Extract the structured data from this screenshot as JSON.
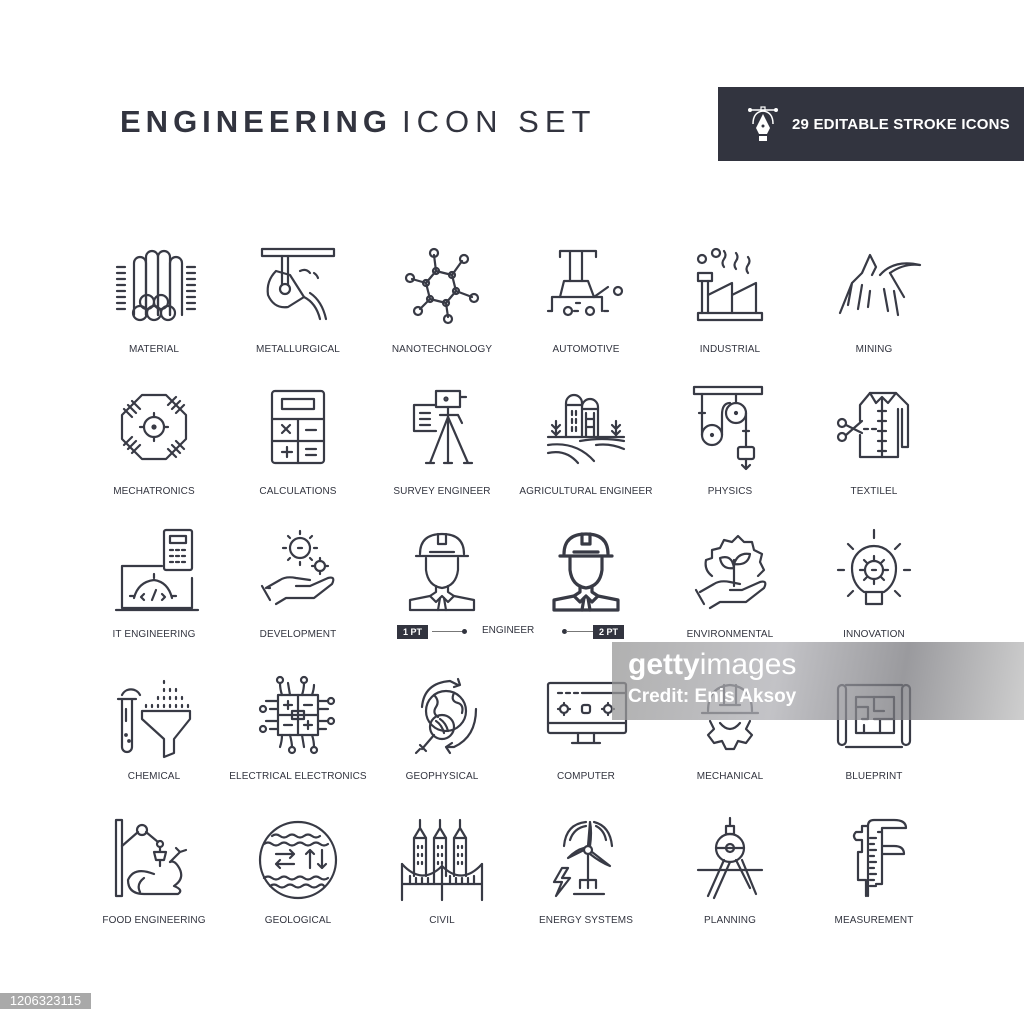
{
  "header": {
    "title_bold": "ENGINEERING",
    "title_light": "ICON SET",
    "badge_icon": "pen-tool-icon",
    "badge_text": "29 EDITABLE STROKE ICONS"
  },
  "icons": [
    {
      "label": "MATERIAL",
      "icon": "pipes-icon"
    },
    {
      "label": "METALLURGICAL",
      "icon": "ladle-icon"
    },
    {
      "label": "NANOTECHNOLOGY",
      "icon": "molecule-icon"
    },
    {
      "label": "AUTOMOTIVE",
      "icon": "car-lift-icon"
    },
    {
      "label": "INDUSTRIAL",
      "icon": "factory-icon"
    },
    {
      "label": "MINING",
      "icon": "pickaxe-mountain-icon"
    },
    {
      "label": "MECHATRONICS",
      "icon": "circuit-octagon-icon"
    },
    {
      "label": "CALCULATIONS",
      "icon": "calculator-icon"
    },
    {
      "label": "SURVEY ENGINEER",
      "icon": "survey-tripod-icon"
    },
    {
      "label": "AGRICULTURAL ENGINEER",
      "icon": "farm-silo-icon"
    },
    {
      "label": "PHYSICS",
      "icon": "pulley-icon"
    },
    {
      "label": "TEXTILEL",
      "icon": "shirt-scissors-icon"
    },
    {
      "label": "IT ENGINEERING",
      "icon": "laptop-code-icon"
    },
    {
      "label": "DEVELOPMENT",
      "icon": "hand-gears-icon"
    },
    {
      "label": "",
      "icon": "engineer-thin-icon"
    },
    {
      "label": "",
      "icon": "engineer-bold-icon"
    },
    {
      "label": "ENVIRONMENTAL",
      "icon": "hand-plant-gear-icon"
    },
    {
      "label": "INNOVATION",
      "icon": "lightbulb-gear-icon"
    },
    {
      "label": "CHEMICAL",
      "icon": "test-tube-funnel-icon"
    },
    {
      "label": "ELECTRICAL ELECTRONICS",
      "icon": "chip-icon"
    },
    {
      "label": "GEOPHYSICAL",
      "icon": "globe-magnifier-icon"
    },
    {
      "label": "COMPUTER",
      "icon": "monitor-gears-icon"
    },
    {
      "label": "MECHANICAL",
      "icon": "helmet-gear-icon"
    },
    {
      "label": "BLUEPRINT",
      "icon": "blueprint-icon"
    },
    {
      "label": "FOOD ENGINEERING",
      "icon": "robot-arm-chicken-icon"
    },
    {
      "label": "GEOLOGICAL",
      "icon": "earth-layers-icon"
    },
    {
      "label": "CIVIL",
      "icon": "towers-bridge-icon"
    },
    {
      "label": "ENERGY SYSTEMS",
      "icon": "wind-turbine-icon"
    },
    {
      "label": "PLANNING",
      "icon": "compass-icon"
    },
    {
      "label": "MEASUREMENT",
      "icon": "caliper-icon"
    }
  ],
  "engineer_comparison": {
    "left_badge": "1 PT",
    "label": "ENGINEER",
    "right_badge": "2 PT"
  },
  "watermark": {
    "brand_bold": "getty",
    "brand_light": "images",
    "credit_prefix": "Credit:",
    "credit_name": "Enis Aksoy"
  },
  "image_id": "1206323115"
}
